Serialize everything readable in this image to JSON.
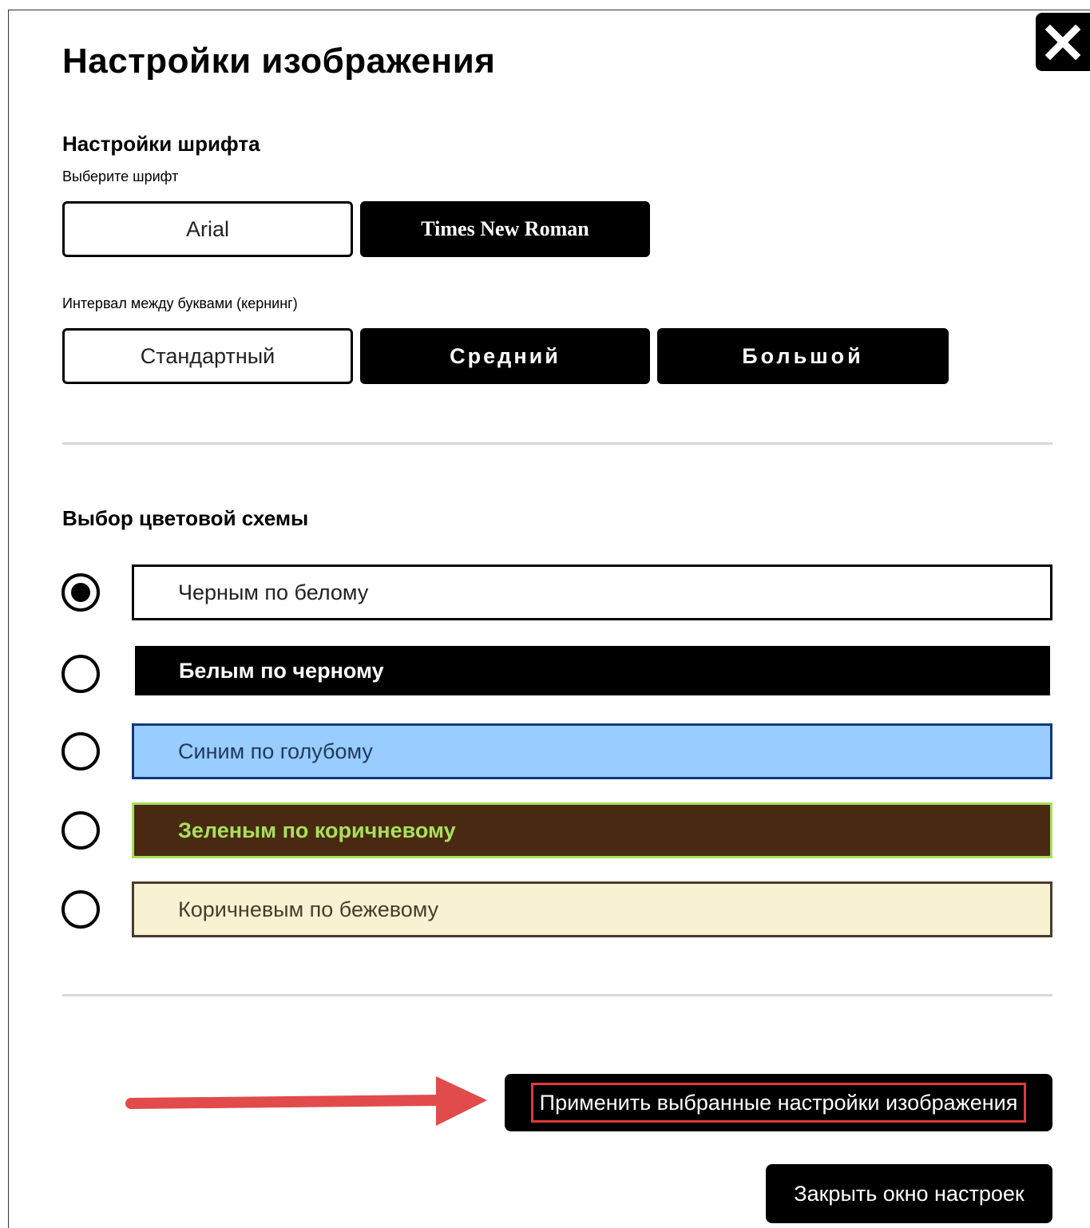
{
  "dialog": {
    "title": "Настройки изображения",
    "close_icon": "close-icon"
  },
  "font_settings": {
    "heading": "Настройки шрифта",
    "choose_label": "Выберите шрифт",
    "fonts": [
      "Arial",
      "Times New Roman"
    ],
    "kerning_label": "Интервал между буквами (кернинг)",
    "kerning_options": [
      "Стандартный",
      "Средний",
      "Большой"
    ]
  },
  "color_scheme": {
    "heading": "Выбор цветовой схемы",
    "selected_index": 0,
    "options": [
      {
        "label": "Черным по белому",
        "bg": "#ffffff",
        "fg": "#222222",
        "border": "#000000"
      },
      {
        "label": "Белым по черному",
        "bg": "#000000",
        "fg": "#ffffff",
        "border": "#000000"
      },
      {
        "label": "Синим по голубому",
        "bg": "#99ccff",
        "fg": "#1f3a5c",
        "border": "#0d3a7a"
      },
      {
        "label": "Зеленым по коричневому",
        "bg": "#4a2913",
        "fg": "#a7e05a",
        "border": "#a7e05a"
      },
      {
        "label": "Коричневым по бежевому",
        "bg": "#f8f2d3",
        "fg": "#4a3b2a",
        "border": "#4a3b2a"
      }
    ]
  },
  "actions": {
    "apply_label": "Применить выбранные настройки изображения",
    "close_label": "Закрыть окно настроек"
  },
  "annotation": {
    "arrow_color": "#e24b4b",
    "highlight_color": "#e0393c"
  }
}
